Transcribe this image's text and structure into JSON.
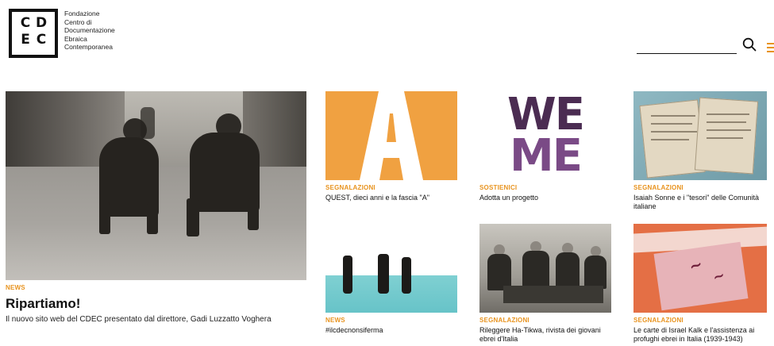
{
  "header": {
    "logo": {
      "letters": [
        "C",
        "D",
        "E",
        "C"
      ],
      "name_lines": [
        "Fondazione",
        "Centro di",
        "Documentazione",
        "Ebraica",
        "Contemporanea"
      ]
    },
    "search": {
      "value": "",
      "placeholder": ""
    },
    "icons": {
      "search": "search-icon",
      "menu": "hamburger-menu-icon"
    }
  },
  "featured": {
    "category": "NEWS",
    "title": "Ripartiamo!",
    "subtitle": "Il nuovo sito web del CDEC presentato dal direttore, Gadi Luzzatto Voghera"
  },
  "cards": [
    {
      "category": "SEGNALAZIONI",
      "title": "QUEST, dieci anni e la fascia \"A\"",
      "image_text": "A"
    },
    {
      "category": "SOSTIENICI",
      "title": "Adotta un progetto",
      "image_text_top": "WE",
      "image_text_bottom": "ME"
    },
    {
      "category": "SEGNALAZIONI",
      "title": "Isaiah Sonne e i \"tesori\" delle Comunità italiane"
    },
    {
      "category": "NEWS",
      "title": "#ilcdecnonsiferma"
    },
    {
      "category": "SEGNALAZIONI",
      "title": "Rileggere Ha-Tikwa, rivista dei giovani ebrei d'Italia"
    },
    {
      "category": "SEGNALAZIONI",
      "title": "Le carte di Israel Kalk e l'assistenza ai profughi ebrei in Italia (1939-1943)"
    }
  ],
  "colors": {
    "accent": "#e8931e",
    "tile_orange": "#f0a141",
    "weme_purple": "#4b2c52"
  }
}
